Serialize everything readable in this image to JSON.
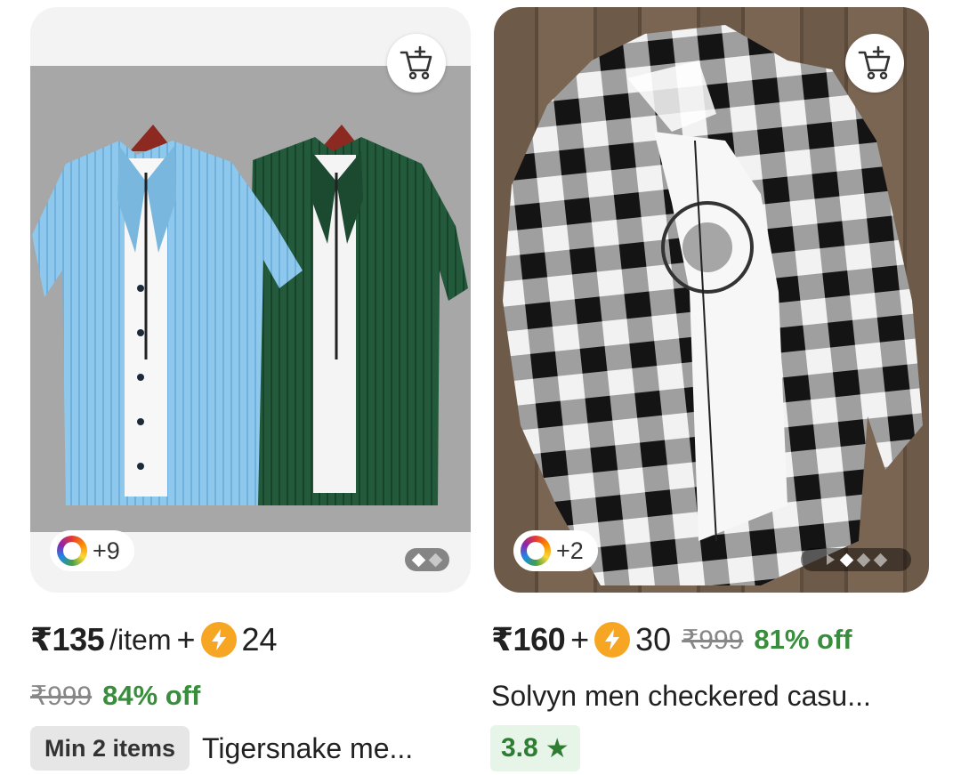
{
  "products": [
    {
      "price": "₹135",
      "unit": "/item",
      "plus": "+",
      "coins": "24",
      "mrp": "₹999",
      "discount": "84% off",
      "min_items": "Min 2 items",
      "title": "Tigersnake me...",
      "colors_more": "+9",
      "icons": [
        "cart-plus-icon",
        "color-wheel-icon"
      ]
    },
    {
      "price": "₹160",
      "plus": "+",
      "coins": "30",
      "mrp": "₹999",
      "discount": "81% off",
      "title": "Solvyn men checkered casu...",
      "rating": "3.8",
      "rating_star": "★",
      "colors_more": "+2",
      "icons": [
        "cart-plus-icon",
        "color-wheel-icon",
        "star-icon"
      ]
    }
  ],
  "colors": {
    "discount_green": "#388e3c",
    "coin_orange": "#f6a623",
    "rating_bg": "#e7f5e9"
  }
}
